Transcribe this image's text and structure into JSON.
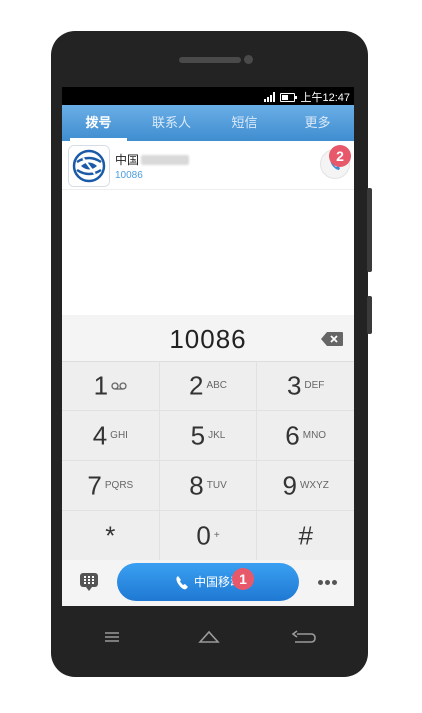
{
  "status_bar": {
    "time": "上午12:47"
  },
  "tabs": [
    {
      "label": "拨号",
      "active": true
    },
    {
      "label": "联系人",
      "active": false
    },
    {
      "label": "短信",
      "active": false
    },
    {
      "label": "更多",
      "active": false
    }
  ],
  "contact": {
    "name": "中国",
    "number": "10086"
  },
  "dialer": {
    "number": "10086"
  },
  "keys": [
    [
      {
        "digit": "1",
        "letters": ""
      },
      {
        "digit": "2",
        "letters": "ABC"
      },
      {
        "digit": "3",
        "letters": "DEF"
      }
    ],
    [
      {
        "digit": "4",
        "letters": "GHI"
      },
      {
        "digit": "5",
        "letters": "JKL"
      },
      {
        "digit": "6",
        "letters": "MNO"
      }
    ],
    [
      {
        "digit": "7",
        "letters": "PQRS"
      },
      {
        "digit": "8",
        "letters": "TUV"
      },
      {
        "digit": "9",
        "letters": "WXYZ"
      }
    ],
    [
      {
        "digit": "*",
        "letters": ""
      },
      {
        "digit": "0",
        "letters": "+"
      },
      {
        "digit": "#",
        "letters": ""
      }
    ]
  ],
  "call_button": {
    "label": "中国移动"
  },
  "badges": {
    "one": "1",
    "two": "2"
  },
  "colors": {
    "accent": "#3f8dd0",
    "badge": "#e8586b"
  }
}
